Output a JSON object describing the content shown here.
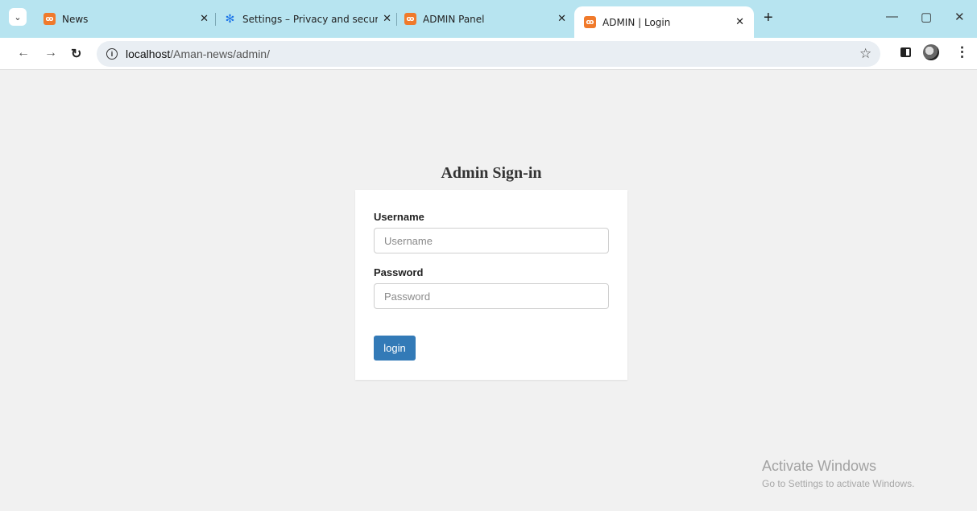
{
  "browser": {
    "tabs": [
      {
        "title": "News",
        "icon": "xampp-icon",
        "active": false
      },
      {
        "title": "Settings – Privacy and security",
        "icon": "gear-icon",
        "active": false
      },
      {
        "title": "ADMIN Panel",
        "icon": "xampp-icon",
        "active": false
      },
      {
        "title": "ADMIN | Login",
        "icon": "xampp-icon",
        "active": true
      }
    ],
    "url_host": "localhost",
    "url_path": "/Aman-news/admin/"
  },
  "page": {
    "title": "Admin Sign-in",
    "username_label": "Username",
    "username_placeholder": "Username",
    "password_label": "Password",
    "password_placeholder": "Password",
    "login_label": "login"
  },
  "watermark": {
    "title": "Activate Windows",
    "subtitle": "Go to Settings to activate Windows."
  },
  "colors": {
    "tabstrip": "#b7e4f0",
    "page_bg": "#f1f1f1",
    "button": "#337ab7"
  }
}
